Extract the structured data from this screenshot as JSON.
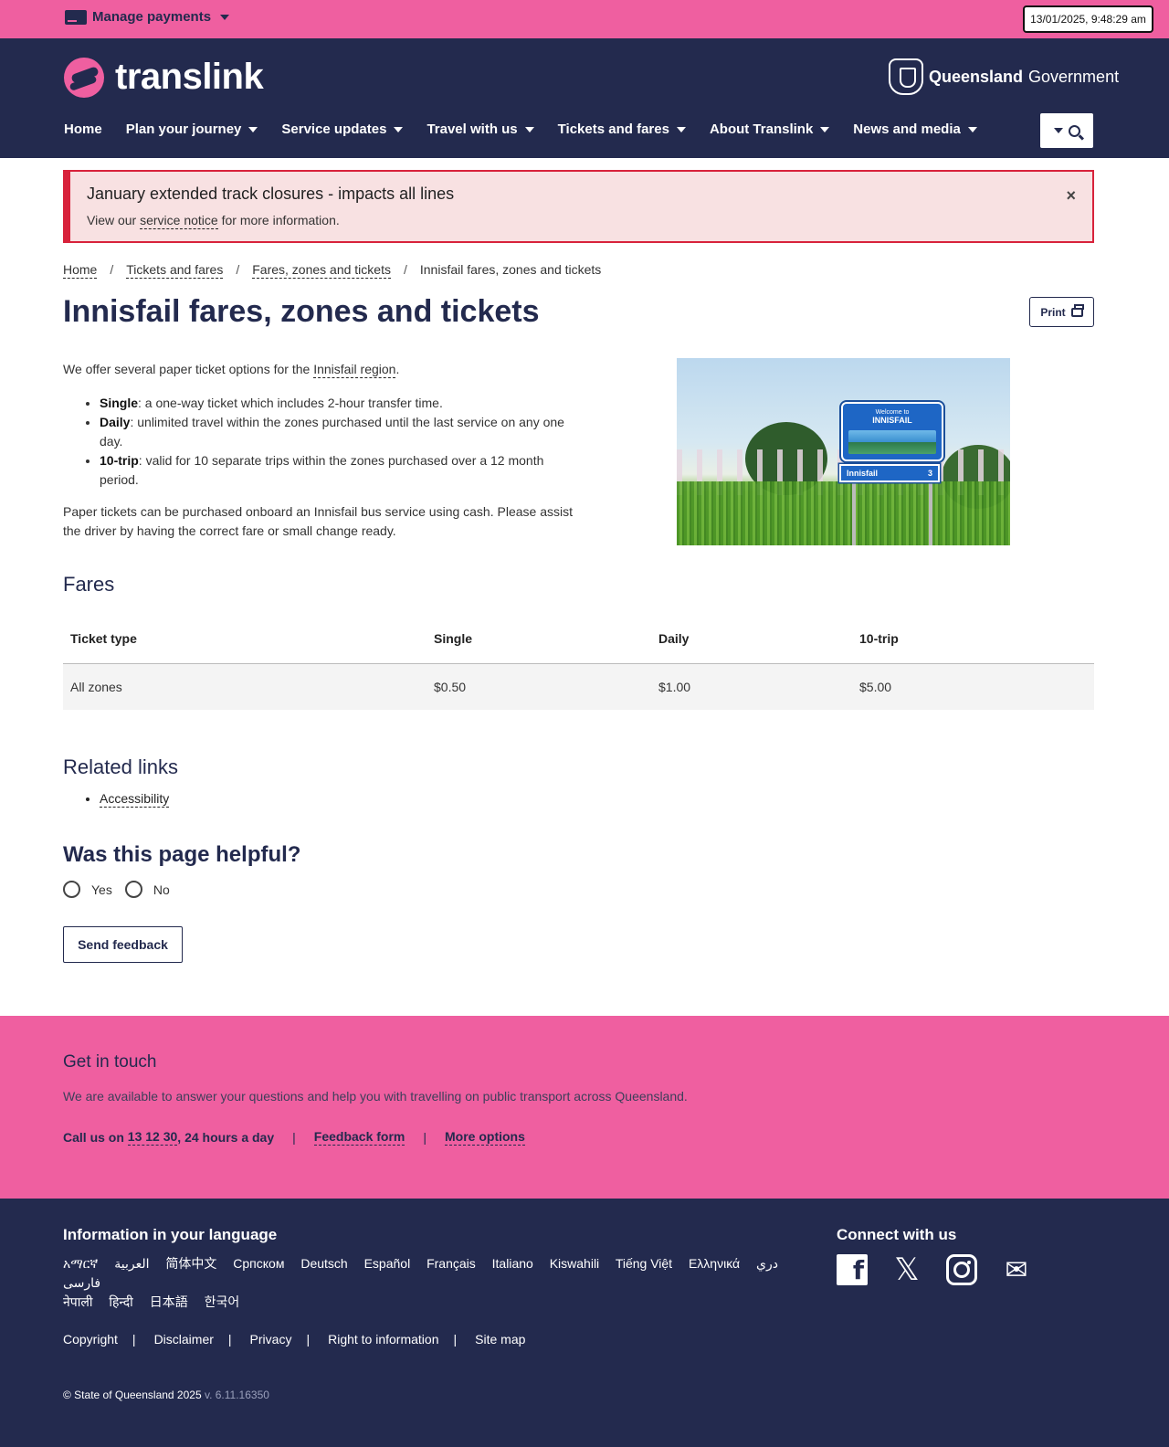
{
  "topbar": {
    "manage_label": "Manage payments",
    "datetime": "13/01/2025, 9:48:29 am"
  },
  "header": {
    "logo_text": "translink",
    "gov_bold": "Queensland",
    "gov_rest": "Government",
    "nav": [
      {
        "label": "Home"
      },
      {
        "label": "Plan your journey"
      },
      {
        "label": "Service updates"
      },
      {
        "label": "Travel with us"
      },
      {
        "label": "Tickets and fares"
      },
      {
        "label": "About Translink"
      },
      {
        "label": "News and media"
      }
    ]
  },
  "alert": {
    "title": "January extended track closures - impacts all lines",
    "body_prefix": "View our ",
    "link": "service notice",
    "body_suffix": " for more information.",
    "close": "×"
  },
  "breadcrumb": {
    "items": [
      "Home",
      "Tickets and fares",
      "Fares, zones and tickets"
    ],
    "current": "Innisfail fares, zones and tickets",
    "separator": "/"
  },
  "page": {
    "title": "Innisfail fares, zones and tickets",
    "print_label": "Print",
    "intro_prefix": "We offer several paper ticket options for the ",
    "intro_link": "Innisfail region",
    "intro_suffix": ".",
    "tickets": [
      {
        "name": "Single",
        "desc": ": a one-way ticket which includes 2-hour transfer time."
      },
      {
        "name": "Daily",
        "desc": ": unlimited travel within the zones purchased until the last service on any one day."
      },
      {
        "name": "10-trip",
        "desc": ": valid for 10 separate trips within the zones purchased over a 12 month period."
      }
    ],
    "purchase_note": "Paper tickets can be purchased onboard an Innisfail bus service using cash. Please assist the driver by having the correct fare or small change ready.",
    "photo": {
      "sign_top": "Welcome to",
      "sign_name": "INNISFAIL",
      "sign_lower": "Innisfail",
      "sign_number": "3"
    }
  },
  "fares": {
    "heading": "Fares",
    "columns": [
      "Ticket type",
      "Single",
      "Daily",
      "10-trip"
    ],
    "rows": [
      [
        "All zones",
        "$0.50",
        "$1.00",
        "$5.00"
      ]
    ]
  },
  "related": {
    "heading": "Related links",
    "links": [
      "Accessibility"
    ]
  },
  "feedback": {
    "question": "Was this page helpful?",
    "options": [
      "Yes",
      "No"
    ],
    "send_label": "Send feedback"
  },
  "contact": {
    "heading": "Get in touch",
    "text": "We are available to answer your questions and help you with travelling on public transport across Queensland.",
    "call_prefix": "Call us on ",
    "phone": "13 12 30",
    "call_suffix": ", 24 hours a day",
    "feedback_link": "Feedback form",
    "more_link": "More options",
    "separator": "|"
  },
  "footer": {
    "lang_title": "Information in your language",
    "languages": [
      "አማርኛ",
      "العربية",
      "简体中文",
      "Српском",
      "Deutsch",
      "Español",
      "Français",
      "Italiano",
      "Kiswahili",
      "Tiếng Việt",
      "Ελληνικά",
      "دري",
      "فارسی",
      "नेपाली",
      "हिन्दी",
      "日本語",
      "한국어"
    ],
    "connect_title": "Connect with us",
    "socials": [
      "facebook-icon",
      "x-icon",
      "instagram-icon",
      "email-icon"
    ],
    "links": [
      "Copyright",
      "Disclaimer",
      "Privacy",
      "Right to information",
      "Site map"
    ],
    "separator": "|",
    "copyright": "© State of Queensland 2025",
    "version": "v. 6.11.16350"
  },
  "colors": {
    "pink": "#ef5fa0",
    "navy": "#232a4e",
    "alert_red": "#d8223b",
    "alert_bg": "#f8e1e2"
  }
}
